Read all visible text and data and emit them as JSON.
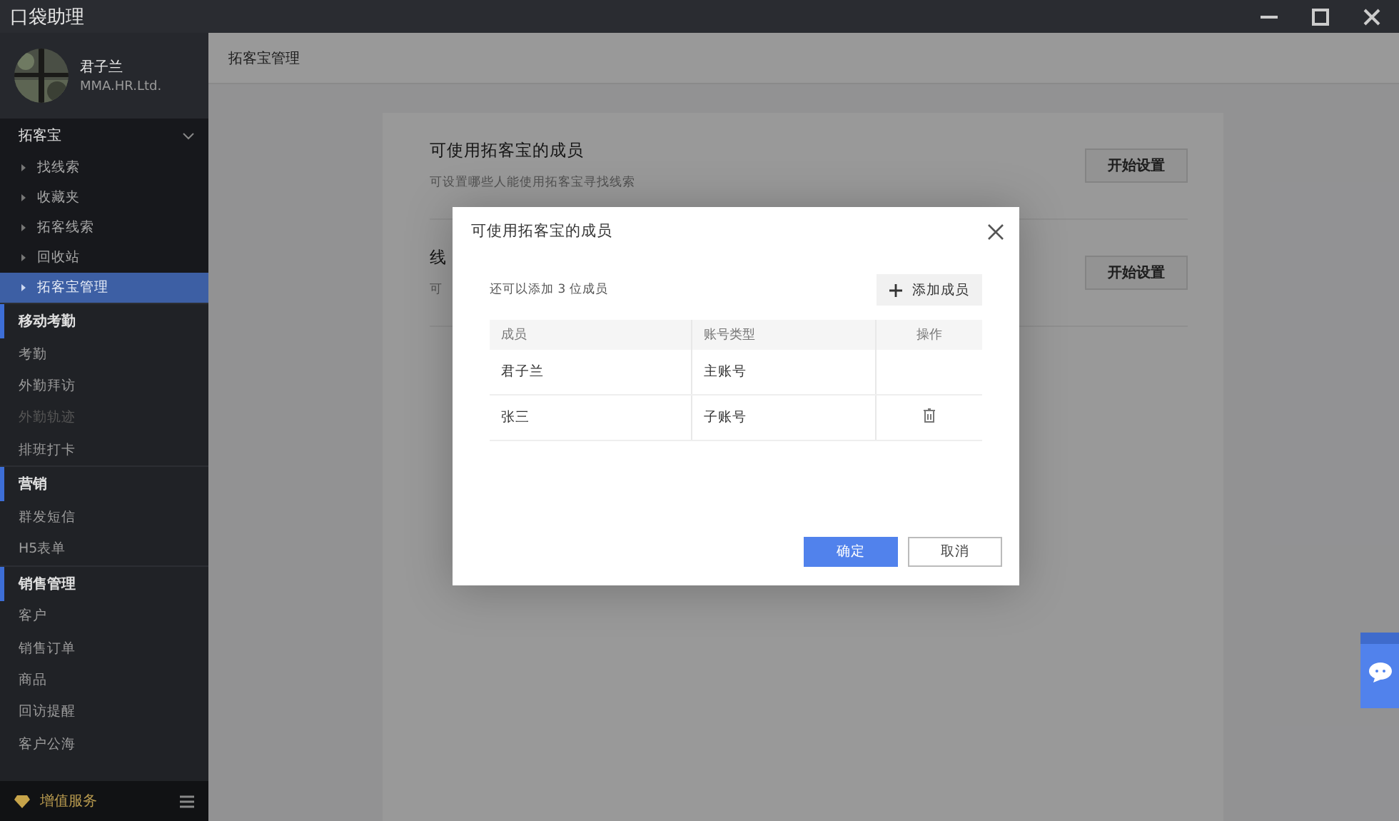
{
  "window": {
    "title": "口袋助理"
  },
  "profile": {
    "name": "君子兰",
    "company": "MMA.HR.Ltd."
  },
  "sidebar": {
    "groups": [
      {
        "label": "拓客宝",
        "kind": "collapsible",
        "expanded": true,
        "items": [
          {
            "label": "找线索",
            "selected": false,
            "disabled": false
          },
          {
            "label": "收藏夹",
            "selected": false,
            "disabled": false
          },
          {
            "label": "拓客线索",
            "selected": false,
            "disabled": false
          },
          {
            "label": "回收站",
            "selected": false,
            "disabled": false
          },
          {
            "label": "拓客宝管理",
            "selected": true,
            "disabled": false
          }
        ]
      },
      {
        "label": "移动考勤",
        "kind": "section",
        "items": [
          {
            "label": "考勤",
            "selected": false,
            "disabled": false
          },
          {
            "label": "外勤拜访",
            "selected": false,
            "disabled": false
          },
          {
            "label": "外勤轨迹",
            "selected": false,
            "disabled": true
          },
          {
            "label": "排班打卡",
            "selected": false,
            "disabled": false
          }
        ]
      },
      {
        "label": "营销",
        "kind": "section",
        "items": [
          {
            "label": "群发短信",
            "selected": false,
            "disabled": false
          },
          {
            "label": "H5表单",
            "selected": false,
            "disabled": false
          }
        ]
      },
      {
        "label": "销售管理",
        "kind": "section",
        "items": [
          {
            "label": "客户",
            "selected": false,
            "disabled": false
          },
          {
            "label": "销售订单",
            "selected": false,
            "disabled": false
          },
          {
            "label": "商品",
            "selected": false,
            "disabled": false
          },
          {
            "label": "回访提醒",
            "selected": false,
            "disabled": false
          },
          {
            "label": "客户公海",
            "selected": false,
            "disabled": false
          }
        ]
      }
    ],
    "footer": {
      "label": "增值服务"
    }
  },
  "page": {
    "title": "拓客宝管理",
    "cards": [
      {
        "title": "可使用拓客宝的成员",
        "description": "可设置哪些人能使用拓客宝寻找线索",
        "button": "开始设置"
      },
      {
        "title": "线",
        "description": "可",
        "button": "开始设置"
      }
    ]
  },
  "dialog": {
    "title": "可使用拓客宝的成员",
    "hint": "还可以添加 3 位成员",
    "add_button": "添加成员",
    "columns": [
      "成员",
      "账号类型",
      "操作"
    ],
    "rows": [
      {
        "member": "君子兰",
        "account_type": "主账号",
        "deletable": false
      },
      {
        "member": "张三",
        "account_type": "子账号",
        "deletable": true
      }
    ],
    "confirm": "确定",
    "cancel": "取消"
  }
}
